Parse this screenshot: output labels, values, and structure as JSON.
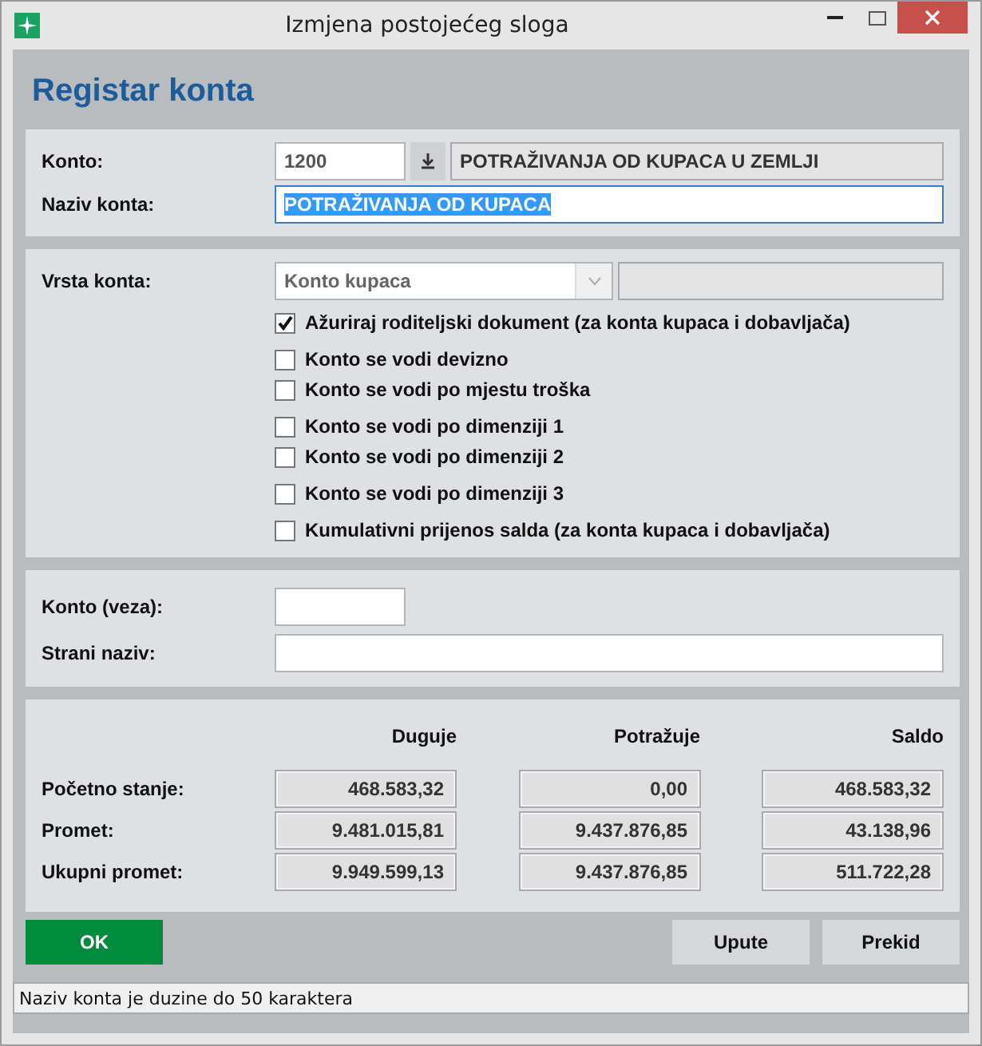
{
  "window": {
    "title": "Izmjena postojećeg sloga"
  },
  "heading": "Registar konta",
  "account": {
    "label": "Konto:",
    "code": "1200",
    "parent_name": "POTRAŽIVANJA OD KUPACA U ZEMLJI"
  },
  "account_name": {
    "label": "Naziv konta:",
    "value": "POTRAŽIVANJA OD KUPACA",
    "selected": true
  },
  "account_type": {
    "label": "Vrsta konta:",
    "value": "Konto kupaca"
  },
  "options": [
    {
      "label": "Ažuriraj roditeljski dokument (za konta kupaca i dobavljača)",
      "checked": true
    },
    {
      "label": "Konto se vodi devizno",
      "checked": false
    },
    {
      "label": "Konto se vodi po mjestu troška",
      "checked": false
    },
    {
      "label": "Konto se vodi po dimenziji 1",
      "checked": false
    },
    {
      "label": "Konto se vodi po dimenziji 2",
      "checked": false
    },
    {
      "label": "Konto se vodi po dimenziji 3",
      "checked": false
    },
    {
      "label": "Kumulativni prijenos salda (za konta kupaca i dobavljača)",
      "checked": false
    }
  ],
  "link_account": {
    "label": "Konto (veza):"
  },
  "foreign_name": {
    "label": "Strani naziv:"
  },
  "totals": {
    "columns": [
      "Duguje",
      "Potražuje",
      "Saldo"
    ],
    "rows": [
      {
        "label": "Početno stanje:",
        "values": [
          "468.583,32",
          "0,00",
          "468.583,32"
        ]
      },
      {
        "label": "Promet:",
        "values": [
          "9.481.015,81",
          "9.437.876,85",
          "43.138,96"
        ]
      },
      {
        "label": "Ukupni promet:",
        "values": [
          "9.949.599,13",
          "9.437.876,85",
          "511.722,28"
        ]
      }
    ]
  },
  "buttons": [
    {
      "label": "OK",
      "kind": "primary"
    },
    {
      "label": "Upute",
      "kind": "normal"
    },
    {
      "label": "Prekid",
      "kind": "normal"
    }
  ],
  "status_bar": "Naziv konta je duzine do 50 karaktera"
}
